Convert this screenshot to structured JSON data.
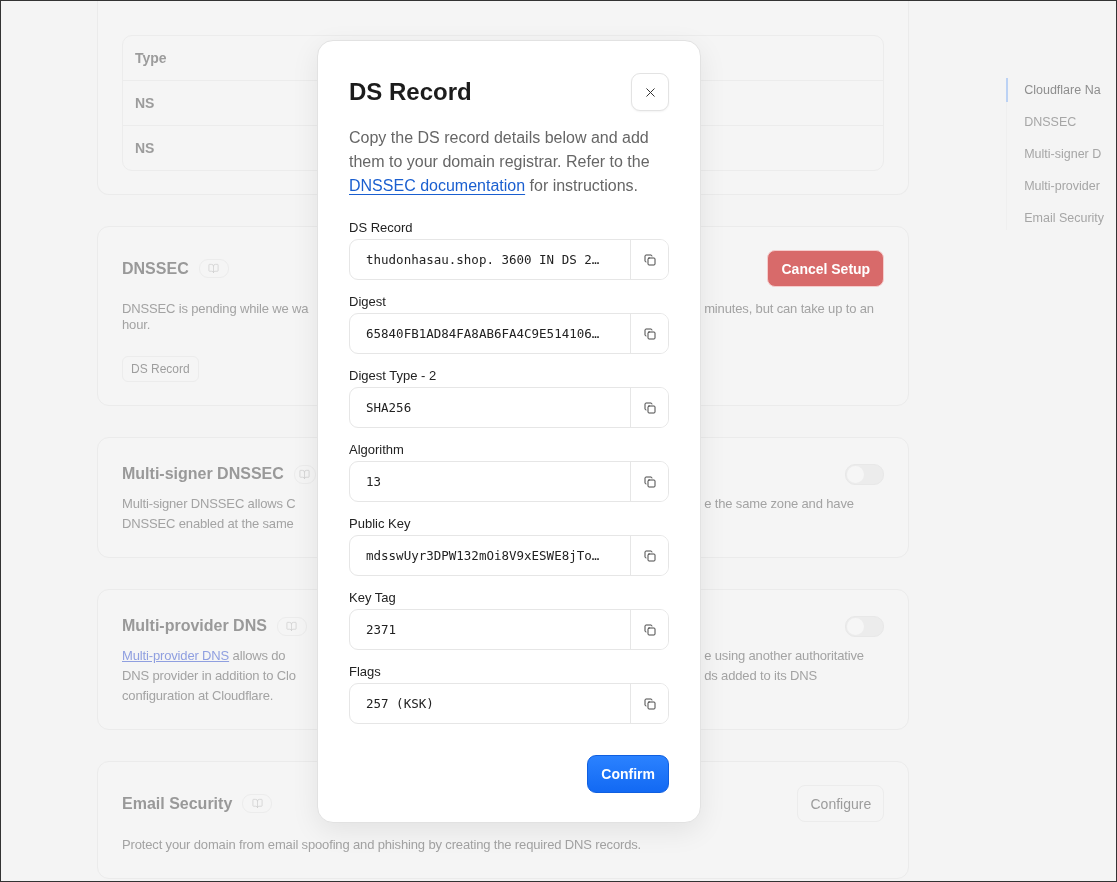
{
  "table": {
    "header": "Type",
    "rows": [
      "NS",
      "NS"
    ]
  },
  "sections": [
    {
      "title": "DNSSEC",
      "action": {
        "kind": "danger",
        "label": "Cancel Setup"
      },
      "lines": [
        {
          "left": "DNSSEC is pending while we wa",
          "right": "minutes, but can take up to an"
        },
        {
          "left": "hour."
        }
      ],
      "footer_button": "DS Record"
    },
    {
      "title": "Multi-signer DNSSEC",
      "action": {
        "kind": "toggle",
        "on": false
      },
      "lines": [
        {
          "left": "Multi-signer DNSSEC allows C",
          "right": "e the same zone and have"
        },
        {
          "left": "DNSSEC enabled at the same"
        }
      ]
    },
    {
      "title": "Multi-provider DNS",
      "action": {
        "kind": "toggle",
        "on": false
      },
      "lines": [
        {
          "link": "Multi-provider DNS",
          "left": "allows do",
          "right": "e using another authoritative"
        },
        {
          "left": "DNS provider in addition to Clo",
          "right": "ds added to its DNS"
        },
        {
          "left": "configuration at Cloudflare."
        }
      ]
    },
    {
      "title": "Email Security",
      "action": {
        "kind": "outline",
        "label": "Configure"
      },
      "lines": [
        {
          "full": "Protect your domain from email spoofing and phishing by creating the required DNS records."
        }
      ]
    }
  ],
  "nav": [
    {
      "label": "Cloudflare Na",
      "selected": true
    },
    {
      "label": "DNSSEC",
      "selected": false
    },
    {
      "label": "Multi-signer D",
      "selected": false
    },
    {
      "label": "Multi-provider",
      "selected": false
    },
    {
      "label": "Email Security",
      "selected": false
    }
  ],
  "modal": {
    "title": "DS Record",
    "description": {
      "before": "Copy the DS record details below and add them to your domain registrar. Refer to the",
      "link": "DNSSEC documentation",
      "after": "for instructions."
    },
    "fields": [
      {
        "label": "DS Record",
        "value": "thudonhasau.shop. 3600 IN DS 2…"
      },
      {
        "label": "Digest",
        "value": "65840FB1AD84FA8AB6FA4C9E514106…"
      },
      {
        "label": "Digest Type - 2",
        "value": "SHA256"
      },
      {
        "label": "Algorithm",
        "value": "13"
      },
      {
        "label": "Public Key",
        "value": "mdsswUyr3DPW132mOi8V9xESWE8jTo…"
      },
      {
        "label": "Key Tag",
        "value": "2371"
      },
      {
        "label": "Flags",
        "value": "257 (KSK)"
      }
    ],
    "confirm": "Confirm"
  }
}
